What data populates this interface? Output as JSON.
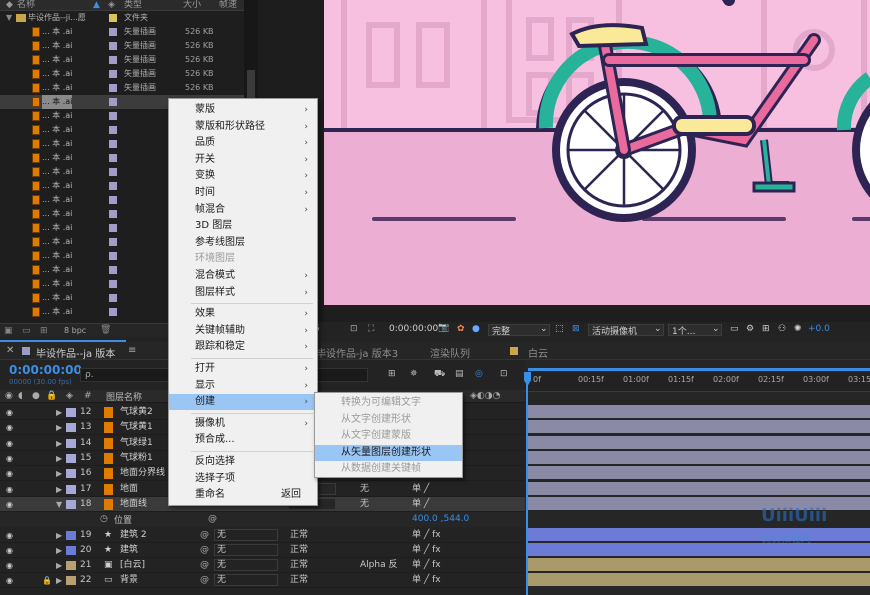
{
  "project": {
    "col_name": "名称",
    "col_type": "类型",
    "col_size": "大小",
    "col_fps": "帧速",
    "folder": {
      "name": "毕设作品--ji...愿",
      "type": "文件夹"
    },
    "items": [
      {
        "name": "... 本 .ai",
        "type": "矢量插画",
        "size": "526 KB"
      },
      {
        "name": "... 本 .ai",
        "type": "矢量插画",
        "size": "526 KB"
      },
      {
        "name": "... 本 .ai",
        "type": "矢量插画",
        "size": "526 KB"
      },
      {
        "name": "... 本 .ai",
        "type": "矢量插画",
        "size": "526 KB"
      },
      {
        "name": "... 本 .ai",
        "type": "矢量插画",
        "size": "526 KB"
      },
      {
        "name": "... 本 .ai",
        "type": "",
        "size": ""
      },
      {
        "name": "... 本 .ai",
        "type": "",
        "size": ""
      },
      {
        "name": "... 本 .ai",
        "type": "",
        "size": ""
      },
      {
        "name": "... 本 .ai",
        "type": "",
        "size": ""
      },
      {
        "name": "... 本 .ai",
        "type": "",
        "size": ""
      },
      {
        "name": "... 本 .ai",
        "type": "",
        "size": ""
      },
      {
        "name": "... 本 .ai",
        "type": "",
        "size": ""
      },
      {
        "name": "... 本 .ai",
        "type": "",
        "size": ""
      },
      {
        "name": "... 本 .ai",
        "type": "",
        "size": ""
      },
      {
        "name": "... 本 .ai",
        "type": "",
        "size": ""
      },
      {
        "name": "... 本 .ai",
        "type": "",
        "size": ""
      },
      {
        "name": "... 本 .ai",
        "type": "",
        "size": ""
      },
      {
        "name": "... 本 .ai",
        "type": "",
        "size": ""
      },
      {
        "name": "... 本 .ai",
        "type": "",
        "size": ""
      },
      {
        "name": "... 本 .ai",
        "type": "",
        "size": ""
      },
      {
        "name": "... 本 .ai",
        "type": "",
        "size": ""
      }
    ],
    "bpc": "8 bpc"
  },
  "viewer": {
    "timecode": "0:00:00:00",
    "quality": "完整",
    "camera": "活动摄像机",
    "views": "1个...",
    "exposure": "+0.0"
  },
  "timeline": {
    "tab1": "毕设作品--ja 版本",
    "tab2": "毕设作品-ja 版本3",
    "tab3": "渲染队列",
    "tab4": "白云",
    "timecode": "0:00:00:00",
    "fps": "00000 (30.00 fps)",
    "search_placeholder": "ρ.",
    "col_layer_name": "图层名称",
    "ruler": [
      "0f",
      "00:15f",
      "01:00f",
      "01:15f",
      "02:00f",
      "02:15f",
      "03:00f",
      "03:15f"
    ],
    "layers": [
      {
        "num": "12",
        "name": "气球黄2",
        "color": "#a8a8d8"
      },
      {
        "num": "13",
        "name": "气球黄1",
        "color": "#a8a8d8"
      },
      {
        "num": "14",
        "name": "气球绿1",
        "color": "#a8a8d8"
      },
      {
        "num": "15",
        "name": "气球粉1",
        "color": "#a8a8d8"
      },
      {
        "num": "16",
        "name": "地面分界线",
        "color": "#a8a8d8"
      },
      {
        "num": "17",
        "name": "地面",
        "color": "#a8a8d8"
      },
      {
        "num": "18",
        "name": "地面线",
        "color": "#a8a8d8"
      }
    ],
    "prop_position": "位置",
    "position_value": "400.0 ,544.0",
    "lower_layers": [
      {
        "num": "19",
        "name": "建筑 2",
        "mode": "正常",
        "none": "无",
        "color": "#6b7bd6"
      },
      {
        "num": "20",
        "name": "建筑",
        "mode": "正常",
        "none": "无",
        "color": "#6b7bd6"
      },
      {
        "num": "21",
        "name": "[白云]",
        "mode": "正常",
        "none": "无",
        "trk": "Alpha 反",
        "color": "#b8a070"
      },
      {
        "num": "22",
        "name": "背景",
        "mode": "正常",
        "none": "无",
        "color": "#b8a070"
      }
    ],
    "mode_none": "无",
    "mode_normal": "正常"
  },
  "context_menu": {
    "items": [
      {
        "label": "蒙版",
        "arrow": true
      },
      {
        "label": "蒙版和形状路径",
        "arrow": true
      },
      {
        "label": "品质",
        "arrow": true
      },
      {
        "label": "开关",
        "arrow": true
      },
      {
        "label": "变换",
        "arrow": true
      },
      {
        "label": "时间",
        "arrow": true
      },
      {
        "label": "帧混合",
        "arrow": true
      },
      {
        "label": "3D 图层",
        "arrow": false
      },
      {
        "label": "参考线图层",
        "arrow": false
      },
      {
        "label": "环境图层",
        "arrow": false,
        "disabled": true
      },
      {
        "label": "混合模式",
        "arrow": true
      },
      {
        "label": "图层样式",
        "arrow": true
      },
      {
        "label": "效果",
        "arrow": true
      },
      {
        "label": "关键帧辅助",
        "arrow": true
      },
      {
        "label": "跟踪和稳定",
        "arrow": true
      },
      {
        "label": "打开",
        "arrow": true
      },
      {
        "label": "显示",
        "arrow": true
      },
      {
        "label": "创建",
        "arrow": true,
        "highlighted": true
      },
      {
        "label": "摄像机",
        "arrow": true
      },
      {
        "label": "预合成...",
        "arrow": false
      },
      {
        "label": "反向选择",
        "arrow": false
      },
      {
        "label": "选择子项",
        "arrow": false
      },
      {
        "label": "重命名",
        "arrow": false,
        "shortcut": "返回"
      }
    ]
  },
  "submenu": {
    "items": [
      {
        "label": "转换为可编辑文字",
        "disabled": true
      },
      {
        "label": "从文字创建形状",
        "disabled": true
      },
      {
        "label": "从文字创建蒙版",
        "disabled": true
      },
      {
        "label": "从矢量图层创建形状",
        "highlighted": true
      },
      {
        "label": "从数据创建关键帧",
        "disabled": true
      }
    ]
  },
  "watermark": {
    "line1": "UiiiUiii",
    "line2": "优优教程网"
  }
}
